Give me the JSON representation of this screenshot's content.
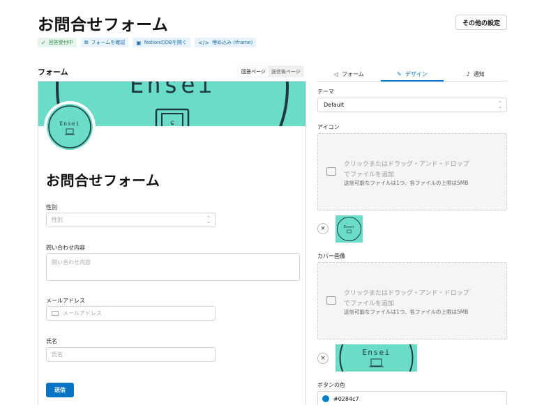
{
  "page": {
    "title": "お問合せフォーム",
    "settings_button": "その他の設定"
  },
  "badges": [
    {
      "icon": "✓",
      "label": "回答受付中"
    },
    {
      "icon": "⧉",
      "label": "フォームを確認"
    },
    {
      "icon": "▣",
      "label": "NotionのDBを開く"
    },
    {
      "icon": "</>",
      "label": "埋め込み (iframe)"
    }
  ],
  "form_section": {
    "title": "フォーム",
    "toggle": [
      "回答ページ",
      "送信後ページ"
    ]
  },
  "form": {
    "cover_text": "Ensei",
    "avatar_text": "Ensei",
    "title": "お問合せフォーム",
    "fields": [
      {
        "label": "性別",
        "placeholder": "性別"
      },
      {
        "label": "問い合わせ内容",
        "placeholder": "問い合わせ内容"
      },
      {
        "label": "メールアドレス",
        "placeholder": "メールアドレス"
      },
      {
        "label": "氏名",
        "placeholder": "氏名"
      }
    ],
    "submit": "送信"
  },
  "tabs": [
    {
      "icon": "◁",
      "label": "フォーム"
    },
    {
      "icon": "✎",
      "label": "デザイン"
    },
    {
      "icon": "♪",
      "label": "通知"
    }
  ],
  "design": {
    "theme_label": "テーマ",
    "theme_value": "Default",
    "icon_label": "アイコン",
    "cover_label": "カバー画像",
    "dropzone": {
      "line1": "クリックまたはドラッグ・アンド・ドロップ",
      "line2": "でファイルを追加",
      "line3": "送信可能なファイルは1つ、各ファイルの上限は5MB"
    },
    "remove": "×",
    "icon_thumb_text": "Ensei",
    "cover_thumb_text": "Ensei",
    "button_color_label": "ボタンの色",
    "button_color_value": "#0284c7"
  },
  "colors": {
    "accent": "#0a74c4",
    "teal": "#6bdcc8",
    "button_color": "#0284c7"
  }
}
